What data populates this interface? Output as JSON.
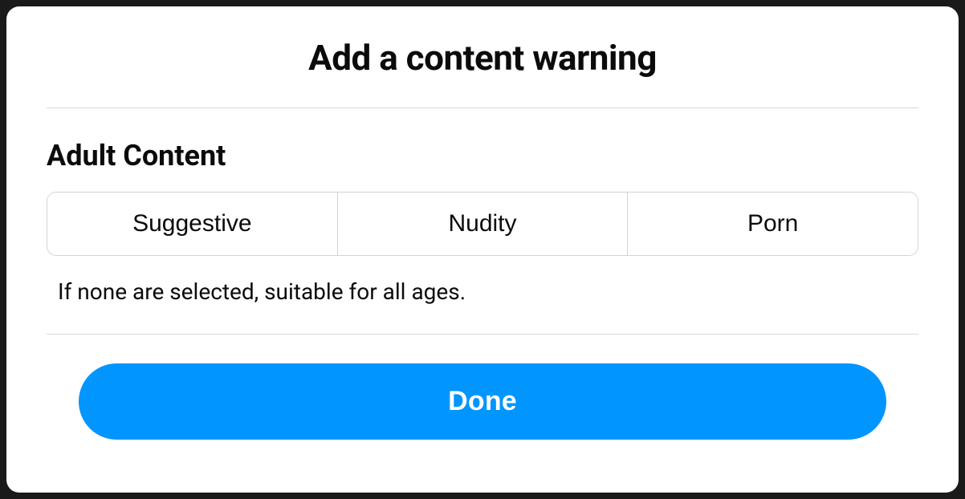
{
  "modal": {
    "title": "Add a content warning"
  },
  "section": {
    "heading": "Adult Content",
    "options": {
      "0": "Suggestive",
      "1": "Nudity",
      "2": "Porn"
    },
    "helper": "If none are selected, suitable for all ages."
  },
  "footer": {
    "done_label": "Done"
  }
}
